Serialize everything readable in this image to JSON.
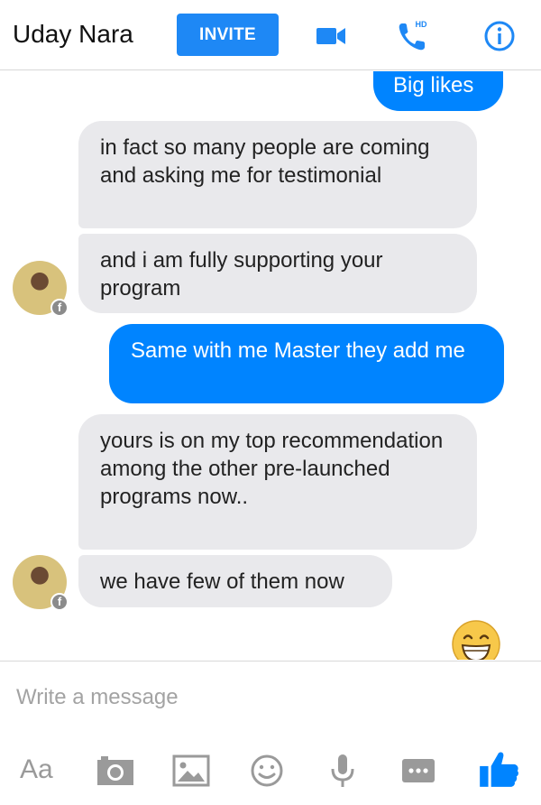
{
  "header": {
    "contact_name": "Uday Nara",
    "invite_label": "INVITE",
    "hd_label": "HD",
    "accent_color": "#1e88f5"
  },
  "messages": [
    {
      "sender": "me",
      "text": "Big likes"
    },
    {
      "sender": "contact",
      "text": "in fact so many people are coming and asking me for testimonial"
    },
    {
      "sender": "contact",
      "text": "and i am fully supporting your program"
    },
    {
      "sender": "me",
      "text": "Same with me Master they add me"
    },
    {
      "sender": "contact",
      "text": "yours is on my top recommendation among the other pre-launched programs now.."
    },
    {
      "sender": "contact",
      "text": "we have few of them now"
    }
  ],
  "composer": {
    "placeholder": "Write a message"
  },
  "toolbar": {
    "text_format_label": "Aa",
    "icons": [
      "camera-icon",
      "image-icon",
      "emoji-icon",
      "microphone-icon",
      "more-icon",
      "thumbs-up-icon"
    ]
  },
  "colors": {
    "outgoing_bubble": "#0084ff",
    "incoming_bubble": "#e9e9ec",
    "like_blue": "#0084ff"
  }
}
